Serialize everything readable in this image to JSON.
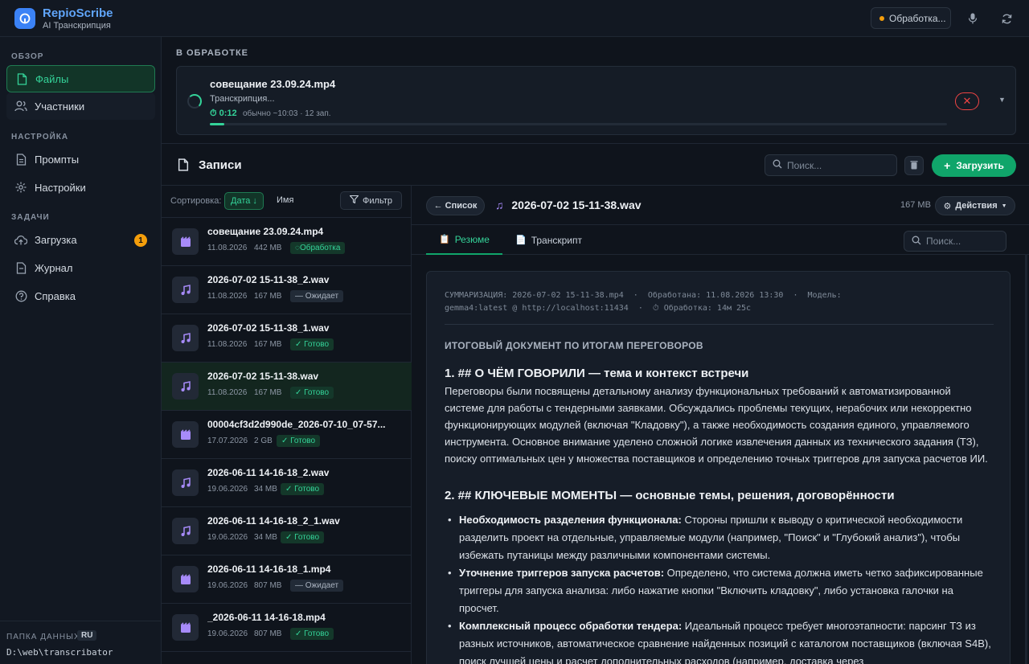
{
  "app": {
    "title": "RepioScribe",
    "subtitle": "AI Транскрипция",
    "status_label": "Обработка..."
  },
  "sidebar": {
    "section_overview": "ОБЗОР",
    "section_settings": "НАСТРОЙКА",
    "section_tasks": "ЗАДАЧИ",
    "items": [
      {
        "label": "Файлы",
        "icon": "file-icon"
      },
      {
        "label": "Участники",
        "icon": "users-icon"
      },
      {
        "label": "Промпты",
        "icon": "document-icon"
      },
      {
        "label": "Настройки",
        "icon": "gear-icon"
      },
      {
        "label": "Загрузка",
        "icon": "upload-icon",
        "badge": "1"
      },
      {
        "label": "Журнал",
        "icon": "log-icon"
      },
      {
        "label": "Справка",
        "icon": "help-icon"
      }
    ],
    "footer": {
      "label": "ПАПКА ДАННЫХ",
      "lang": "RU",
      "path": "D:\\web\\transcribator"
    }
  },
  "processing": {
    "section_title": "В ОБРАБОТКЕ",
    "file_name": "совещание 23.09.24.mp4",
    "state": "Транскрипция...",
    "elapsed": "0:12",
    "meta": "обычно ~10:03 · 12 зап.",
    "progress": 0.02
  },
  "records": {
    "title": "Записи",
    "search_placeholder": "Поиск...",
    "upload_label": "Загрузить"
  },
  "list": {
    "sort_label": "Сортировка:",
    "sort_date": "Дата ↓",
    "sort_name": "Имя",
    "filter_label": "Фильтр",
    "files": [
      {
        "name": "совещание 23.09.24.mp4",
        "date": "11.08.2026",
        "size": "442 MB",
        "status": "Обработка",
        "kind": "video"
      },
      {
        "name": "2026-07-02 15-11-38_2.wav",
        "date": "11.08.2026",
        "size": "167 MB",
        "status": "— Ожидает",
        "kind": "audio"
      },
      {
        "name": "2026-07-02 15-11-38_1.wav",
        "date": "11.08.2026",
        "size": "167 MB",
        "status": "✓ Готово",
        "kind": "audio"
      },
      {
        "name": "2026-07-02 15-11-38.wav",
        "date": "11.08.2026",
        "size": "167 MB",
        "status": "✓ Готово",
        "kind": "audio"
      },
      {
        "name": "00004cf3d2d990de_2026-07-10_07-57...",
        "date": "17.07.2026",
        "size": "2 GB",
        "status": "✓ Готово",
        "kind": "video"
      },
      {
        "name": "2026-06-11 14-16-18_2.wav",
        "date": "19.06.2026",
        "size": "34 MB",
        "status": "✓ Готово",
        "kind": "audio"
      },
      {
        "name": "2026-06-11 14-16-18_2_1.wav",
        "date": "19.06.2026",
        "size": "34 MB",
        "status": "✓ Готово",
        "kind": "audio"
      },
      {
        "name": "2026-06-11 14-16-18_1.mp4",
        "date": "19.06.2026",
        "size": "807 MB",
        "status": "— Ожидает",
        "kind": "video"
      },
      {
        "name": "_2026-06-11 14-16-18.mp4",
        "date": "19.06.2026",
        "size": "807 MB",
        "status": "✓ Готово",
        "kind": "video"
      }
    ]
  },
  "detail": {
    "back_label": "← Список",
    "file_name": "2026-07-02 15-11-38.wav",
    "size": "167 MB",
    "actions_label": "Действия",
    "tabs": [
      {
        "label": "Резюме"
      },
      {
        "label": "Транскрипт"
      }
    ],
    "search_placeholder": "Поиск...",
    "meta_line1": "СУММАРИЗАЦИЯ: 2026-07-02 15-11-38.mp4  ·  Обработана: 11.08.2026 13:30  ·  Модель:",
    "meta_line2": "gemma4:latest @ http://localhost:11434  ·  ⏱ Обработка: 14м 25с",
    "doc_title": "ИТОГОВЫЙ ДОКУМЕНТ ПО ИТОГАМ ПЕРЕГОВОРОВ",
    "h1": "1. ## О ЧЁМ ГОВОРИЛИ — тема и контекст встречи",
    "p1": "Переговоры были посвящены детальному анализу функциональных требований к автоматизированной системе для работы с тендерными заявками. Обсуждались проблемы текущих, нерабочих или некорректно функционирующих модулей (включая \"Кладовку\"), а также необходимость создания единого, управляемого инструмента. Основное внимание уделено сложной логике извлечения данных из технического задания (ТЗ), поиску оптимальных цен у множества поставщиков и определению точных триггеров для запуска расчетов ИИ.",
    "h2": "2. ## КЛЮЧЕВЫЕ МОМЕНТЫ — основные темы, решения, договорённости",
    "bullets": [
      {
        "bold": "Необходимость разделения функционала:",
        "text": " Стороны пришли к выводу о критической необходимости разделить проект на отдельные, управляемые модули (например, \"Поиск\" и \"Глубокий анализ\"), чтобы избежать путаницы между различными компонентами системы."
      },
      {
        "bold": "Уточнение триггеров запуска расчетов:",
        "text": " Определено, что система должна иметь четко зафиксированные триггеры для запуска анализа: либо нажатие кнопки \"Включить кладовку\", либо установка галочки на просчет."
      },
      {
        "bold": "Комплексный процесс обработки тендера:",
        "text": " Идеальный процесс требует многоэтапности: парсинг ТЗ из разных источников, автоматическое сравнение найденных позиций с каталогом поставщиков (включая S4B), поиск лучшей цены и расчет дополнительных расходов (например, доставка через"
      }
    ]
  }
}
